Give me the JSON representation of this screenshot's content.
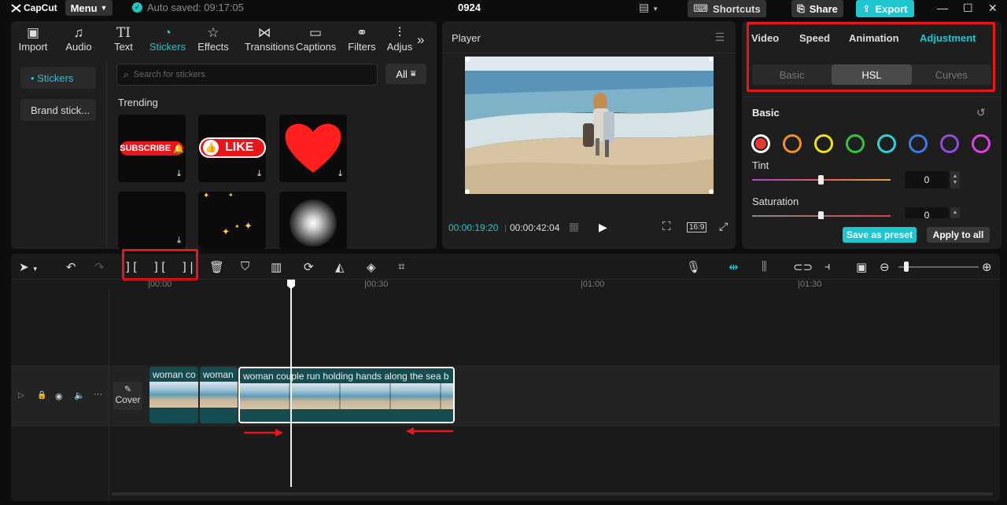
{
  "app": {
    "name": "CapCut",
    "menu_label": "Menu",
    "autosave": "Auto saved: 09:17:05",
    "project": "0924"
  },
  "titlebar": {
    "shortcuts": "Shortcuts",
    "share": "Share",
    "export": "Export"
  },
  "toolbar": [
    {
      "label": "Import",
      "icon": "import-icon"
    },
    {
      "label": "Audio",
      "icon": "audio-icon"
    },
    {
      "label": "Text",
      "icon": "text-icon"
    },
    {
      "label": "Stickers",
      "icon": "stickers-icon",
      "active": true
    },
    {
      "label": "Effects",
      "icon": "effects-icon"
    },
    {
      "label": "Transitions",
      "icon": "transitions-icon"
    },
    {
      "label": "Captions",
      "icon": "captions-icon"
    },
    {
      "label": "Filters",
      "icon": "filters-icon"
    },
    {
      "label": "Adjus",
      "icon": "adjust-icon"
    }
  ],
  "sidebar": {
    "items": [
      {
        "label": "• Stickers"
      },
      {
        "label": "Brand stick..."
      }
    ]
  },
  "stickers": {
    "search_placeholder": "Search for stickers",
    "filter_label": "All",
    "section": "Trending",
    "subscribe_text": "SUBSCRIBE",
    "like_text": "LIKE"
  },
  "player": {
    "title": "Player",
    "current_time": "00:00:19:20",
    "total_time": "00:00:42:04",
    "ratio": "16:9"
  },
  "props": {
    "tabs": [
      "Video",
      "Speed",
      "Animation",
      "Adjustment"
    ],
    "active_tab": "Adjustment",
    "subtabs": [
      "Basic",
      "HSL",
      "Curves"
    ],
    "active_subtab": "HSL",
    "section": "Basic",
    "colors": [
      "#e53935",
      "#f0902a",
      "#f2e01e",
      "#35c43f",
      "#2fd1d6",
      "#3a7de6",
      "#8c4ae6",
      "#e040e6"
    ],
    "tint_label": "Tint",
    "tint_value": "0",
    "saturation_label": "Saturation",
    "saturation_value": "0",
    "save_preset": "Save as preset",
    "apply_all": "Apply to all"
  },
  "timeline": {
    "ruler": [
      "00:00",
      "00:30",
      "01:00",
      "01:30"
    ],
    "cover_label": "Cover",
    "clips": [
      {
        "label": "woman co"
      },
      {
        "label": "woman"
      },
      {
        "label": "woman couple run holding hands along the sea b"
      }
    ]
  }
}
